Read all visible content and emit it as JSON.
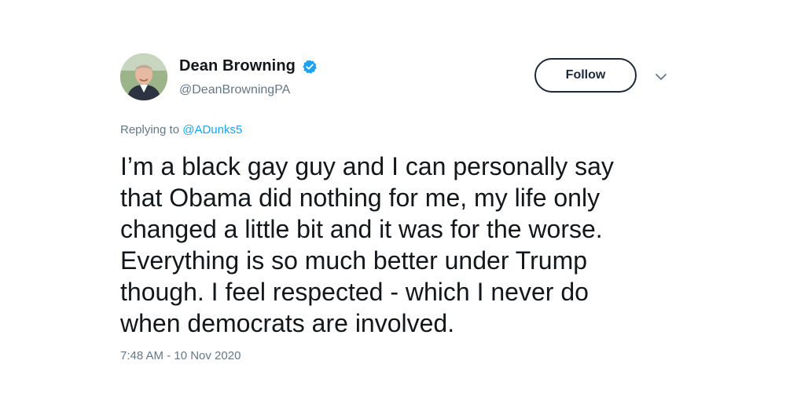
{
  "tweet": {
    "author": {
      "display_name": "Dean Browning",
      "handle": "@DeanBrowningPA",
      "verified": true,
      "avatar_icon": "profile-photo"
    },
    "follow_label": "Follow",
    "more_icon": "chevron-down-icon",
    "reply": {
      "prefix": "Replying to",
      "mention": "@ADunks5"
    },
    "text_lines": [
      "I’m a black gay guy and I can personally say",
      "that Obama did nothing for me, my life only",
      "changed a little bit and it was for the worse.",
      "Everything is so much better under Trump",
      "though. I feel respected - which I never do",
      "when democrats are involved."
    ],
    "timestamp": "7:48 AM - 10 Nov 2020"
  },
  "colors": {
    "text": "#14171a",
    "secondary": "#657786",
    "link": "#1da1f2",
    "verified": "#1da1f2",
    "button_border": "#1c2938"
  }
}
